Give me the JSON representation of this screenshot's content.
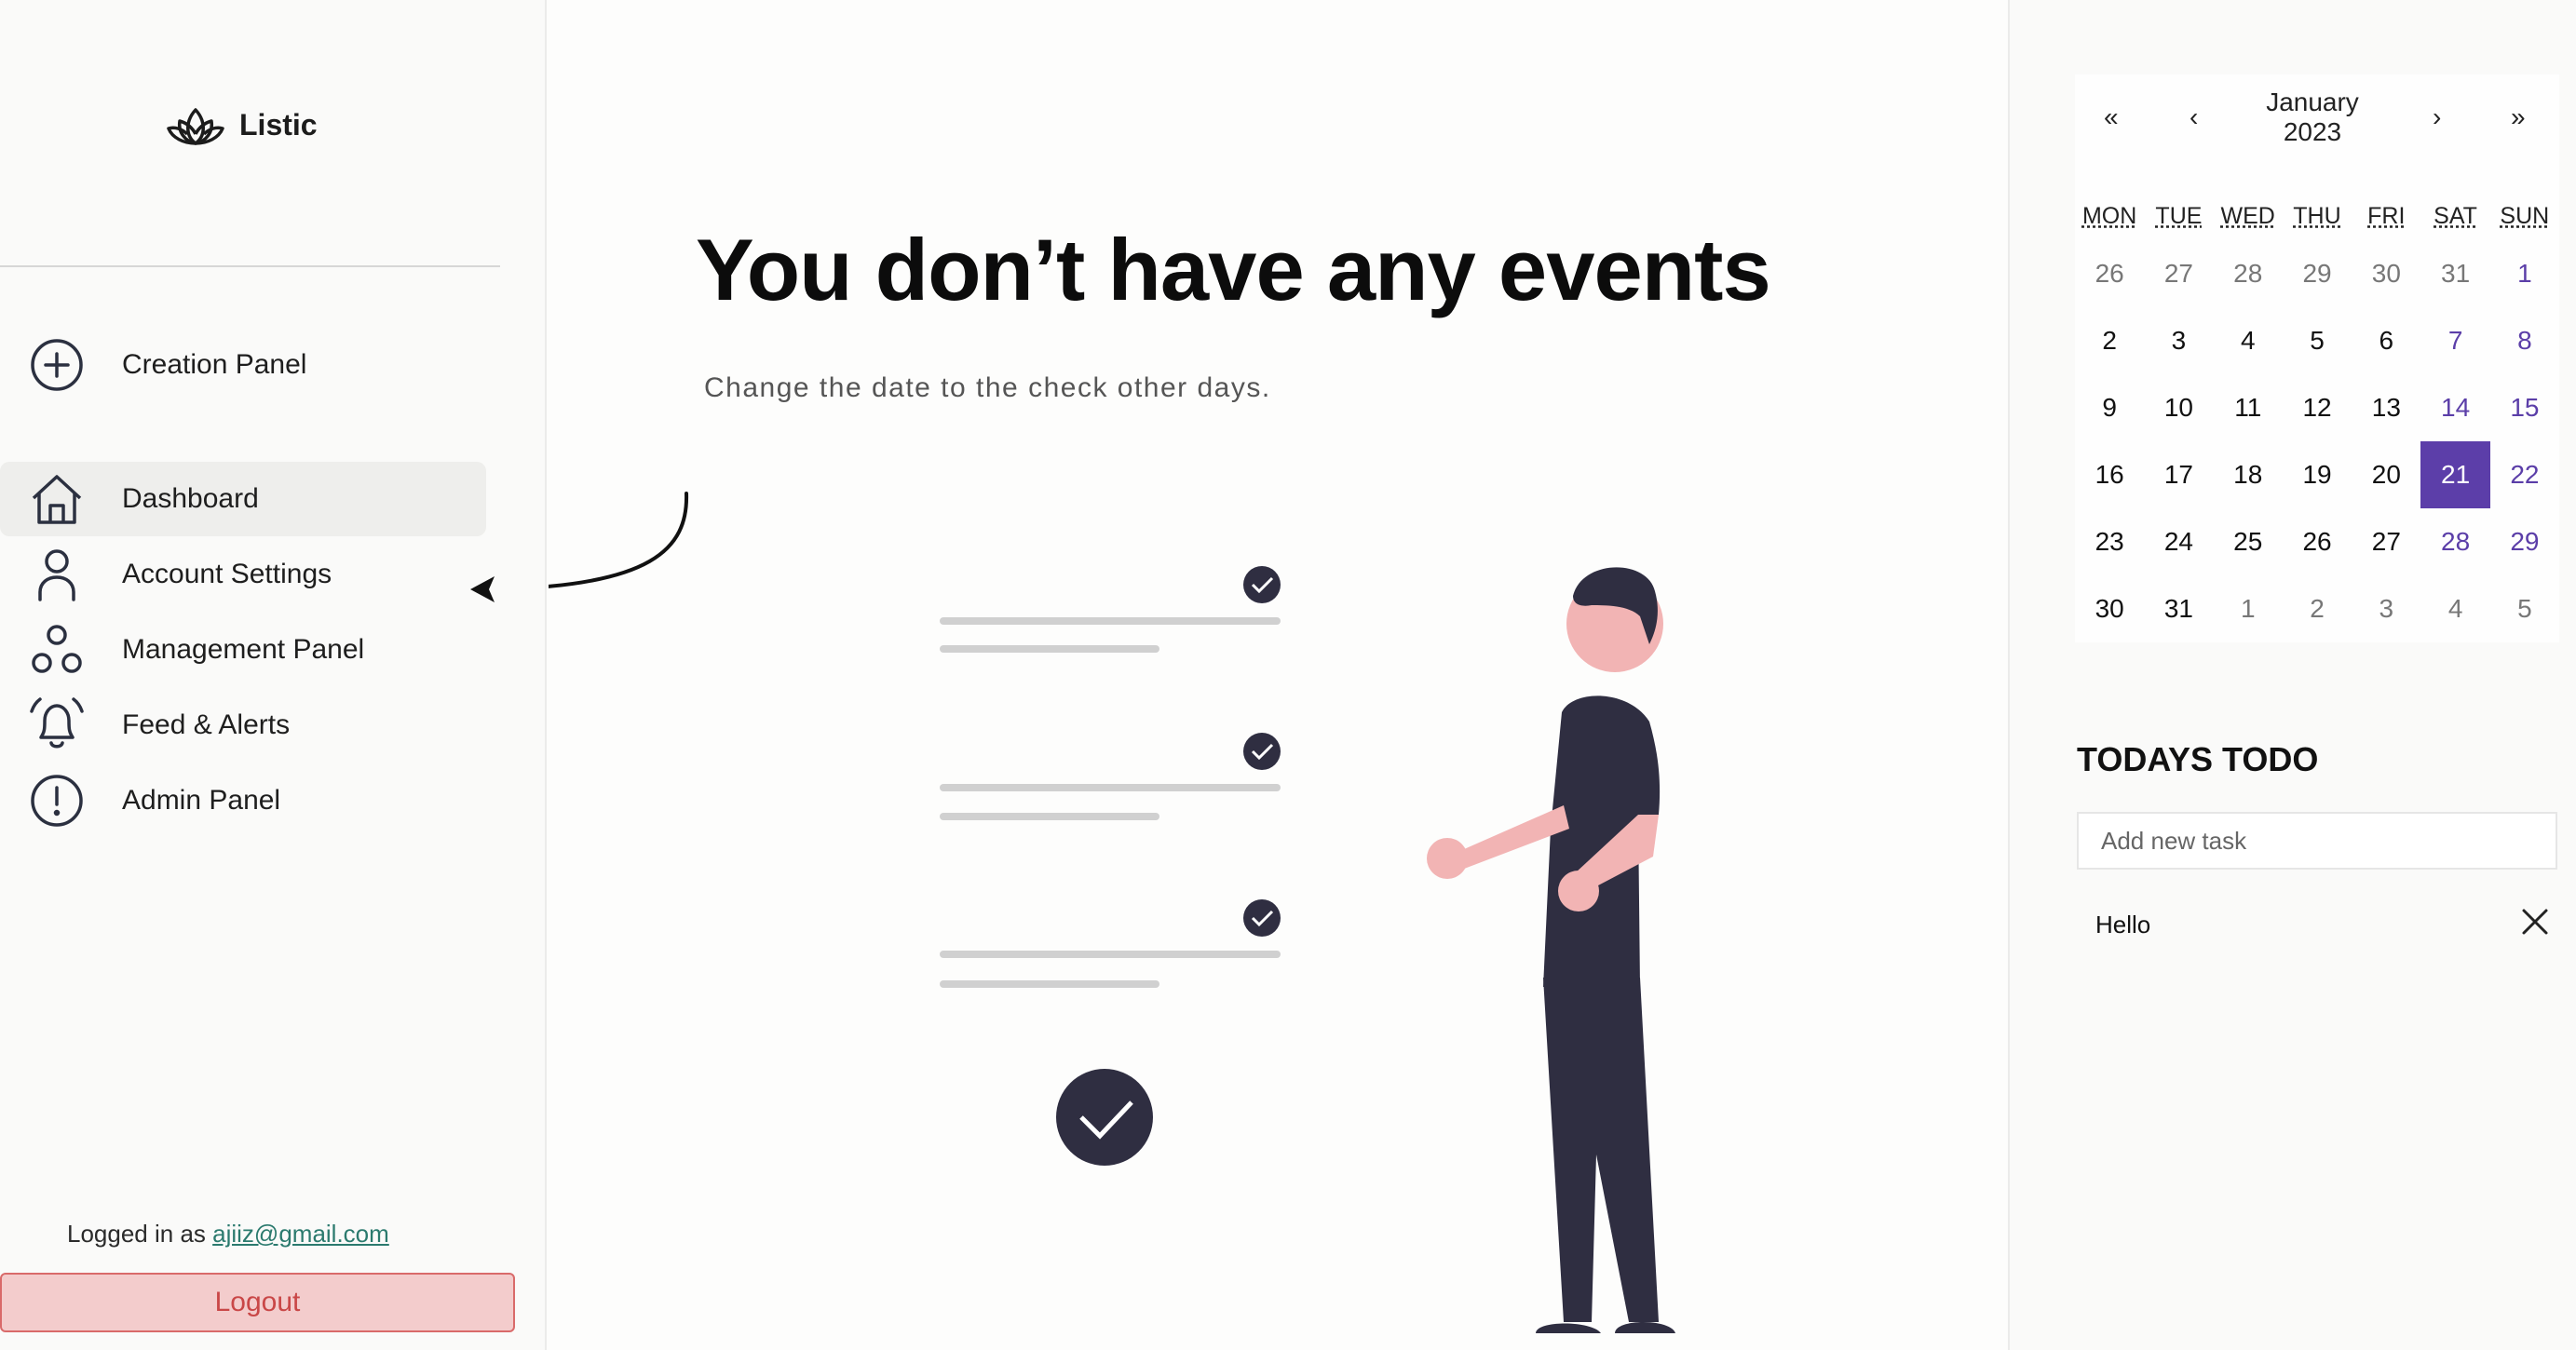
{
  "app": {
    "name": "Listic"
  },
  "sidebar": {
    "creation": {
      "label": "Creation Panel",
      "icon": "plus-circle-icon"
    },
    "items": [
      {
        "label": "Dashboard",
        "icon": "home-icon",
        "active": true
      },
      {
        "label": "Account Settings",
        "icon": "user-icon",
        "active": false
      },
      {
        "label": "Management Panel",
        "icon": "circles-icon",
        "active": false
      },
      {
        "label": "Feed & Alerts",
        "icon": "bell-icon",
        "active": false
      },
      {
        "label": "Admin Panel",
        "icon": "alert-circle-icon",
        "active": false
      }
    ],
    "logged_in_prefix": "Logged in as ",
    "email": "ajiiz@gmail.com",
    "logout_label": "Logout"
  },
  "main": {
    "title": "You don’t have any events",
    "subtitle": "Change the date to the check other days."
  },
  "calendar": {
    "nav": {
      "prev_year": "«",
      "prev_month": "‹",
      "next_month": "›",
      "next_year": "»"
    },
    "month": "January",
    "year": "2023",
    "weekdays": [
      "MON",
      "TUE",
      "WED",
      "THU",
      "FRI",
      "SAT",
      "SUN"
    ],
    "weeks": [
      [
        "26",
        "27",
        "28",
        "29",
        "30",
        "31",
        "1"
      ],
      [
        "2",
        "3",
        "4",
        "5",
        "6",
        "7",
        "8"
      ],
      [
        "9",
        "10",
        "11",
        "12",
        "13",
        "14",
        "15"
      ],
      [
        "16",
        "17",
        "18",
        "19",
        "20",
        "21",
        "22"
      ],
      [
        "23",
        "24",
        "25",
        "26",
        "27",
        "28",
        "29"
      ],
      [
        "30",
        "31",
        "1",
        "2",
        "3",
        "4",
        "5"
      ]
    ],
    "selected_day": "21",
    "accent_color": "#5c3ea9"
  },
  "todo": {
    "title": "TODAYS TODO",
    "placeholder": "Add new task",
    "items": [
      "Hello"
    ]
  },
  "colors": {
    "accent": "#5c3ea9",
    "logout_bg": "#f3cccc",
    "logout_text": "#c94747",
    "illustration_dark": "#2f2e41",
    "illustration_skin": "#f2b4b4"
  }
}
